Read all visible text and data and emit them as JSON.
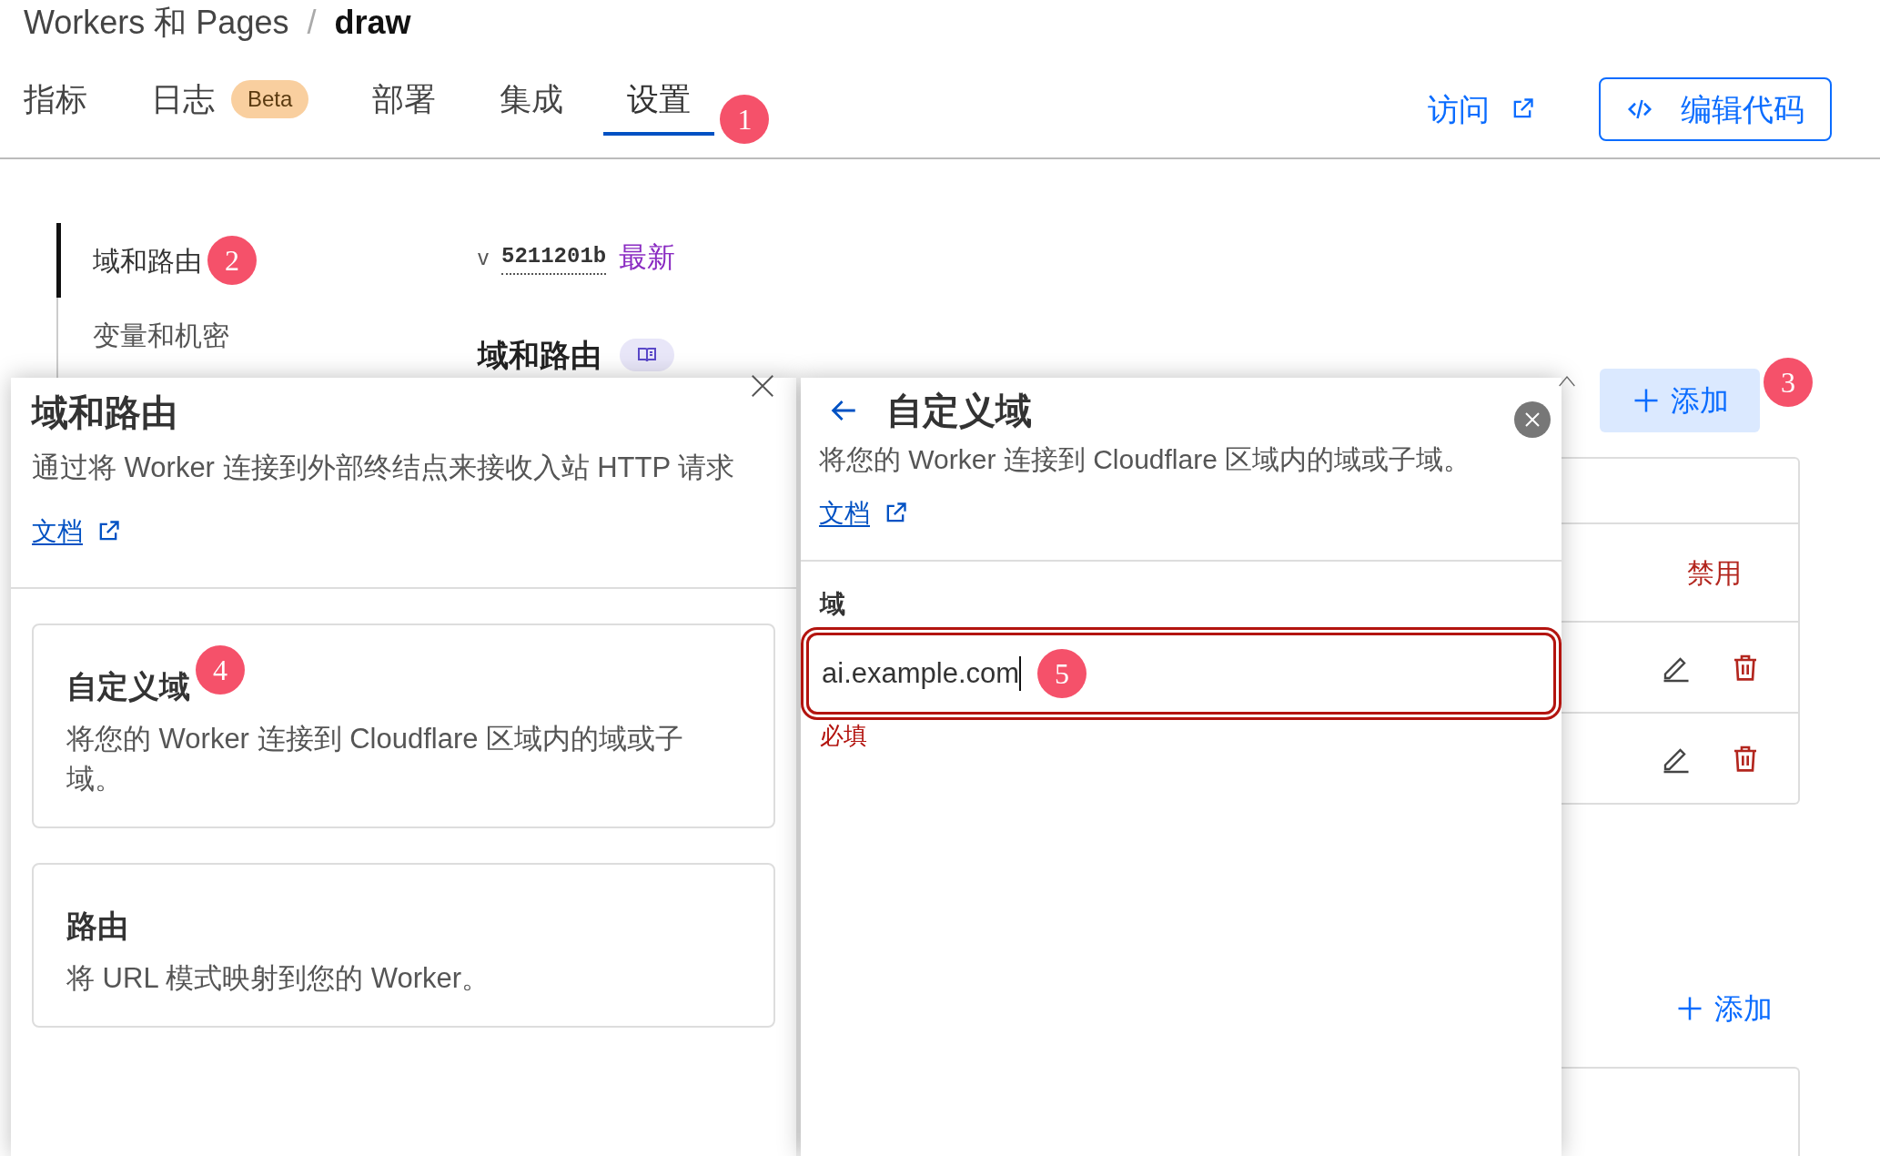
{
  "breadcrumb": {
    "parent": "Workers 和 Pages",
    "separator": "/",
    "current": "draw"
  },
  "tabs": [
    {
      "label": "指标",
      "selected": false
    },
    {
      "label": "日志",
      "badge": "Beta",
      "selected": false
    },
    {
      "label": "部署",
      "selected": false
    },
    {
      "label": "集成",
      "selected": false
    },
    {
      "label": "设置",
      "selected": true,
      "annotation": "1"
    }
  ],
  "header_actions": {
    "visit_link": "访问",
    "edit_code_button": "编辑代码"
  },
  "sidebar": {
    "items": [
      {
        "label": "域和路由",
        "selected": true,
        "annotation": "2"
      },
      {
        "label": "变量和机密",
        "selected": false
      }
    ]
  },
  "version": {
    "prefix": "v",
    "id": "5211201b",
    "status": "最新"
  },
  "section": {
    "title": "域和路由"
  },
  "domains_table": {
    "add_button": {
      "label": "添加",
      "annotation": "3"
    },
    "rows": [
      {
        "kind": "blank"
      },
      {
        "kind": "status",
        "text": "禁用"
      },
      {
        "kind": "actions"
      },
      {
        "kind": "actions"
      }
    ],
    "second_add_link": "添加"
  },
  "routes_panel": {
    "title": "域和路由",
    "description": "通过将 Worker 连接到外部终结点来接收入站 HTTP 请求",
    "docs_link": "文档",
    "options": [
      {
        "title": "自定义域",
        "description": "将您的 Worker 连接到 Cloudflare 区域内的域或子域。",
        "annotation": "4"
      },
      {
        "title": "路由",
        "description": "将 URL 模式映射到您的 Worker。"
      }
    ]
  },
  "custom_domain_panel": {
    "title": "自定义域",
    "description": "将您的 Worker 连接到 Cloudflare 区域内的域或子域。",
    "docs_link": "文档",
    "field": {
      "label": "域",
      "value": "ai.example.com",
      "invalid": true,
      "error": "必填",
      "annotation": "5"
    }
  }
}
